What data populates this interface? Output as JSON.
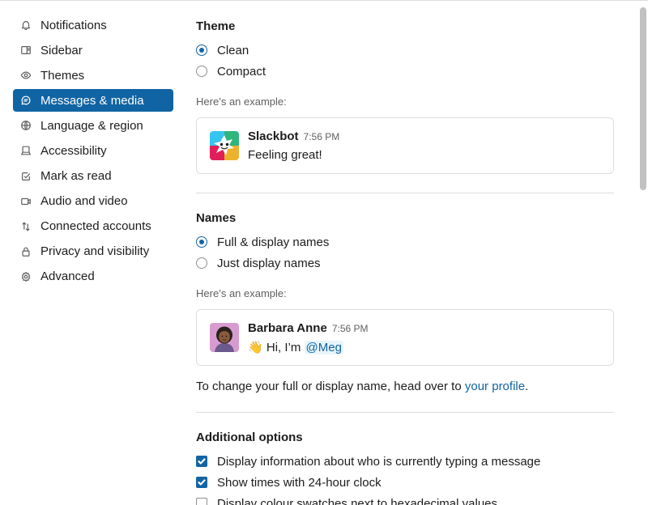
{
  "sidebar": {
    "items": [
      {
        "label": "Notifications",
        "icon": "bell-icon"
      },
      {
        "label": "Sidebar",
        "icon": "sidebar-icon"
      },
      {
        "label": "Themes",
        "icon": "eye-icon"
      },
      {
        "label": "Messages & media",
        "icon": "message-icon",
        "active": true
      },
      {
        "label": "Language & region",
        "icon": "globe-icon"
      },
      {
        "label": "Accessibility",
        "icon": "laptop-icon"
      },
      {
        "label": "Mark as read",
        "icon": "check-square-icon"
      },
      {
        "label": "Audio and video",
        "icon": "video-icon"
      },
      {
        "label": "Connected accounts",
        "icon": "arrows-icon"
      },
      {
        "label": "Privacy and visibility",
        "icon": "lock-icon"
      },
      {
        "label": "Advanced",
        "icon": "gear-icon"
      }
    ]
  },
  "theme": {
    "title": "Theme",
    "options": [
      "Clean",
      "Compact"
    ],
    "selected": "Clean",
    "example_label": "Here’s an example:",
    "example": {
      "name": "Slackbot",
      "time": "7:56 PM",
      "text": "Feeling great!"
    }
  },
  "names": {
    "title": "Names",
    "options": [
      "Full & display names",
      "Just display names"
    ],
    "selected": "Full & display names",
    "example_label": "Here’s an example:",
    "example": {
      "name": "Barbara Anne",
      "time": "7:56 PM",
      "emoji": "👋",
      "text": "Hi, I’m ",
      "mention": "@Meg"
    },
    "note_prefix": "To change your full or display name, head over to ",
    "note_link": "your profile",
    "note_suffix": "."
  },
  "additional": {
    "title": "Additional options",
    "options": [
      {
        "label": "Display information about who is currently typing a message",
        "checked": true
      },
      {
        "label": "Show times with 24-hour clock",
        "checked": true
      },
      {
        "label": "Display colour swatches next to hexadecimal values",
        "checked": false
      }
    ]
  },
  "colors": {
    "accent": "#1264a3",
    "active_bg": "#1164a3",
    "text": "#1d1c1d",
    "muted": "#616061",
    "border": "#dddddd"
  }
}
